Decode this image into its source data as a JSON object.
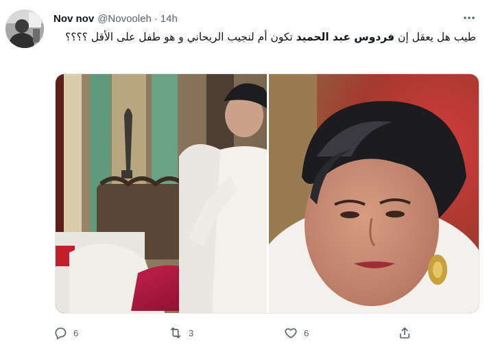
{
  "tweet": {
    "display_name": "Nov nov",
    "handle": "@Novooleh",
    "separator": "·",
    "time": "14h",
    "text_before": "طيب هل يعقل إن ",
    "text_bold": "فردوس عبد الحميد",
    "text_after": " تكون أم لنجيب الريحاني و هو طفل على الأقل ؟؟؟؟"
  },
  "actions": {
    "reply_count": "6",
    "retweet_count": "3",
    "like_count": "6"
  },
  "icons": {
    "more": "more-dots-icon",
    "reply": "reply-icon",
    "retweet": "retweet-icon",
    "like": "heart-icon",
    "share": "share-icon"
  },
  "colors": {
    "text_primary": "#0f1419",
    "text_secondary": "#536471"
  }
}
